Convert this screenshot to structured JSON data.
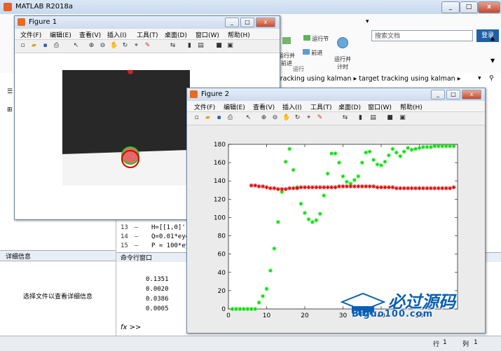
{
  "main": {
    "title": "MATLAB R2018a",
    "search_placeholder": "搜索文档",
    "login": "登录",
    "ribbon": {
      "tab": "运行",
      "buttons": [
        {
          "label": "运行节"
        },
        {
          "label": "运行并\n前进"
        },
        {
          "label": "前进"
        },
        {
          "label": "运行并\n计时"
        }
      ]
    },
    "breadcrumb": [
      "tracking using kalman",
      "target tracking using kalman"
    ],
    "details_header": "详细信息",
    "details_message": "选择文件以查看详细信息",
    "editor_lines": [
      {
        "n": "13",
        "code": "H=[[1,0]',"
      },
      {
        "n": "14",
        "code": "Q=0.01*eye"
      },
      {
        "n": "15",
        "code": "P = 100*eye"
      }
    ],
    "command_header": "命令行窗口",
    "command_values": [
      "0.1351",
      "0.0020",
      "0.0386",
      "0.0005"
    ],
    "prompt": "fx >>",
    "status": {
      "row_label": "行",
      "row": "1",
      "col_label": "列",
      "col": "1"
    }
  },
  "figure1": {
    "title": "Figure 1",
    "menu": [
      "文件(F)",
      "编辑(E)",
      "查看(V)",
      "插入(I)",
      "工具(T)",
      "桌面(D)",
      "窗口(W)",
      "帮助(H)"
    ]
  },
  "figure2": {
    "title": "Figure 2",
    "menu": [
      "文件(F)",
      "编辑(E)",
      "查看(V)",
      "插入(I)",
      "工具(T)",
      "桌面(D)",
      "窗口(W)",
      "帮助(H)"
    ]
  },
  "watermark": {
    "title": "必过源码",
    "url": "Biguo100.com"
  },
  "chart_data": {
    "type": "scatter",
    "title": "",
    "xlabel": "",
    "ylabel": "",
    "xlim": [
      0,
      60
    ],
    "ylim": [
      0,
      180
    ],
    "xticks": [
      0,
      10,
      20,
      30,
      40,
      50
    ],
    "yticks": [
      0,
      20,
      40,
      60,
      80,
      100,
      120,
      140,
      160,
      180
    ],
    "grid": false,
    "series": [
      {
        "color": "#00dd00",
        "marker": "*",
        "points": [
          [
            1,
            0
          ],
          [
            2,
            0
          ],
          [
            3,
            0
          ],
          [
            4,
            0
          ],
          [
            5,
            0
          ],
          [
            6,
            0
          ],
          [
            7,
            0
          ],
          [
            8,
            7
          ],
          [
            9,
            14
          ],
          [
            10,
            22
          ],
          [
            11,
            42
          ],
          [
            12,
            66
          ],
          [
            13,
            95
          ],
          [
            14,
            128
          ],
          [
            15,
            161
          ],
          [
            16,
            175
          ],
          [
            17,
            152
          ],
          [
            18,
            133
          ],
          [
            19,
            115
          ],
          [
            20,
            105
          ],
          [
            21,
            98
          ],
          [
            22,
            95
          ],
          [
            23,
            97
          ],
          [
            24,
            104
          ],
          [
            25,
            124
          ],
          [
            26,
            148
          ],
          [
            27,
            170
          ],
          [
            28,
            170
          ],
          [
            29,
            160
          ],
          [
            30,
            145
          ],
          [
            31,
            139
          ],
          [
            32,
            137
          ],
          [
            33,
            141
          ],
          [
            34,
            145
          ],
          [
            35,
            160
          ],
          [
            36,
            171
          ],
          [
            37,
            172
          ],
          [
            38,
            163
          ],
          [
            39,
            158
          ],
          [
            40,
            157
          ],
          [
            41,
            161
          ],
          [
            42,
            168
          ],
          [
            43,
            175
          ],
          [
            44,
            171
          ],
          [
            45,
            167
          ],
          [
            46,
            172
          ],
          [
            47,
            176
          ],
          [
            48,
            174
          ],
          [
            49,
            175
          ],
          [
            50,
            176
          ],
          [
            51,
            177
          ],
          [
            52,
            177
          ],
          [
            53,
            177
          ],
          [
            54,
            178
          ],
          [
            55,
            178
          ],
          [
            56,
            178
          ],
          [
            57,
            178
          ],
          [
            58,
            178
          ],
          [
            59,
            178
          ]
        ]
      },
      {
        "color": "#dd0000",
        "marker": "*",
        "points": [
          [
            6,
            135
          ],
          [
            7,
            135
          ],
          [
            8,
            134
          ],
          [
            9,
            134
          ],
          [
            10,
            133
          ],
          [
            11,
            132
          ],
          [
            12,
            132
          ],
          [
            13,
            131
          ],
          [
            14,
            131
          ],
          [
            15,
            131
          ],
          [
            16,
            132
          ],
          [
            17,
            132
          ],
          [
            18,
            132
          ],
          [
            19,
            133
          ],
          [
            20,
            133
          ],
          [
            21,
            133
          ],
          [
            22,
            133
          ],
          [
            23,
            133
          ],
          [
            24,
            133
          ],
          [
            25,
            133
          ],
          [
            26,
            133
          ],
          [
            27,
            133
          ],
          [
            28,
            133
          ],
          [
            29,
            134
          ],
          [
            30,
            134
          ],
          [
            31,
            134
          ],
          [
            32,
            134
          ],
          [
            33,
            134
          ],
          [
            34,
            134
          ],
          [
            35,
            134
          ],
          [
            36,
            134
          ],
          [
            37,
            134
          ],
          [
            38,
            134
          ],
          [
            39,
            133
          ],
          [
            40,
            133
          ],
          [
            41,
            133
          ],
          [
            42,
            133
          ],
          [
            43,
            133
          ],
          [
            44,
            132
          ],
          [
            45,
            132
          ],
          [
            46,
            132
          ],
          [
            47,
            132
          ],
          [
            48,
            132
          ],
          [
            49,
            132
          ],
          [
            50,
            132
          ],
          [
            51,
            132
          ],
          [
            52,
            132
          ],
          [
            53,
            132
          ],
          [
            54,
            132
          ],
          [
            55,
            132
          ],
          [
            56,
            132
          ],
          [
            57,
            132
          ],
          [
            58,
            132
          ],
          [
            59,
            133
          ]
        ]
      }
    ]
  }
}
